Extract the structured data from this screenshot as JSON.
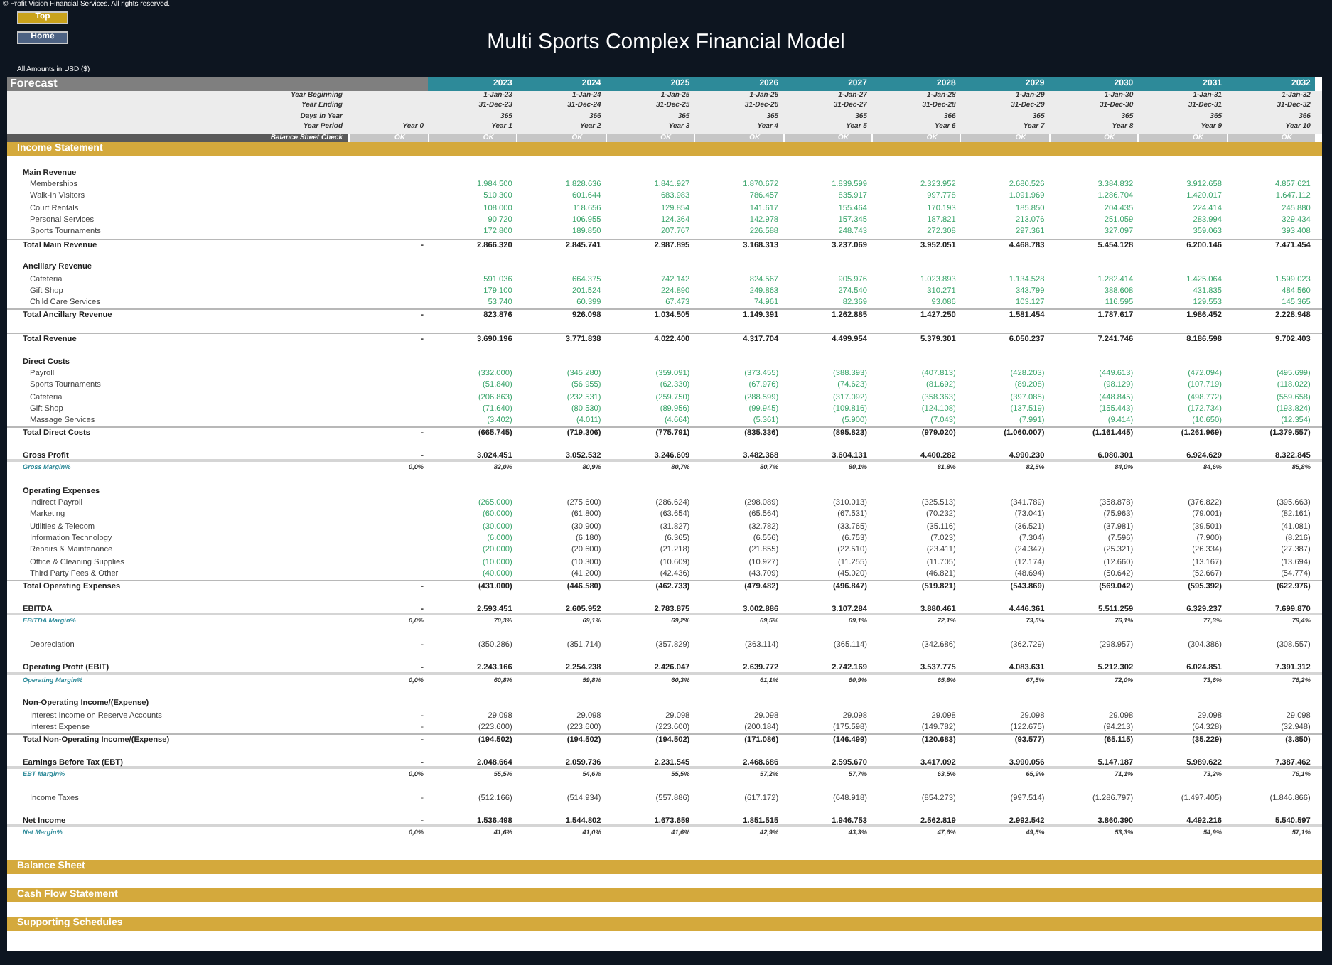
{
  "copyright": "© Profit Vision Financial Services. All rights reserved.",
  "nav_buttons": [
    {
      "label": "Top",
      "kind": "gold"
    },
    {
      "label": "Home",
      "kind": "slate"
    }
  ],
  "title": "Multi Sports Complex Financial Model",
  "currency_note": "All Amounts in  USD ($)",
  "forecast": {
    "label": "Forecast",
    "years": [
      "2023",
      "2024",
      "2025",
      "2026",
      "2027",
      "2028",
      "2029",
      "2030",
      "2031",
      "2032"
    ],
    "header_rows": [
      {
        "label": "Year Beginning",
        "values": [
          "1-Jan-23",
          "1-Jan-24",
          "1-Jan-25",
          "1-Jan-26",
          "1-Jan-27",
          "1-Jan-28",
          "1-Jan-29",
          "1-Jan-30",
          "1-Jan-31",
          "1-Jan-32"
        ]
      },
      {
        "label": "Year Ending",
        "values": [
          "31-Dec-23",
          "31-Dec-24",
          "31-Dec-25",
          "31-Dec-26",
          "31-Dec-27",
          "31-Dec-28",
          "31-Dec-29",
          "31-Dec-30",
          "31-Dec-31",
          "31-Dec-32"
        ]
      },
      {
        "label": "Days in Year",
        "values": [
          "365",
          "366",
          "365",
          "365",
          "365",
          "366",
          "365",
          "365",
          "365",
          "366"
        ]
      },
      {
        "label": "Year Period",
        "year0": "Year 0",
        "values": [
          "Year 1",
          "Year 2",
          "Year 3",
          "Year 4",
          "Year 5",
          "Year 6",
          "Year 7",
          "Year 8",
          "Year 9",
          "Year 10"
        ]
      }
    ],
    "check": {
      "label": "Balance Sheet Check",
      "year0": "OK",
      "values": [
        "OK",
        "OK",
        "OK",
        "OK",
        "OK",
        "OK",
        "OK",
        "OK",
        "OK",
        "OK"
      ]
    }
  },
  "income_statement": {
    "title": "Income Statement",
    "groups": [
      {
        "rows": [
          {
            "kind": "heading",
            "label": "Main Revenue"
          },
          {
            "kind": "input",
            "label": "Memberships",
            "values": [
              "1.984.500",
              "1.828.636",
              "1.841.927",
              "1.870.672",
              "1.839.599",
              "2.323.952",
              "2.680.526",
              "3.384.832",
              "3.912.658",
              "4.857.621"
            ]
          },
          {
            "kind": "input",
            "label": "Walk-In Visitors",
            "values": [
              "510.300",
              "601.644",
              "683.983",
              "786.457",
              "835.917",
              "997.778",
              "1.091.969",
              "1.286.704",
              "1.420.017",
              "1.647.112"
            ]
          },
          {
            "kind": "input",
            "label": "Court Rentals",
            "values": [
              "108.000",
              "118.656",
              "129.854",
              "141.617",
              "155.464",
              "170.193",
              "185.850",
              "204.435",
              "224.414",
              "245.880"
            ]
          },
          {
            "kind": "input",
            "label": "Personal Services",
            "values": [
              "90.720",
              "106.955",
              "124.364",
              "142.978",
              "157.345",
              "187.821",
              "213.076",
              "251.059",
              "283.994",
              "329.434"
            ]
          },
          {
            "kind": "input",
            "label": "Sports Tournaments",
            "values": [
              "172.800",
              "189.850",
              "207.767",
              "226.588",
              "248.743",
              "272.308",
              "297.361",
              "327.097",
              "359.063",
              "393.408"
            ]
          },
          {
            "kind": "total",
            "label": "Total Main Revenue",
            "year0": "-",
            "values": [
              "2.866.320",
              "2.845.741",
              "2.987.895",
              "3.168.313",
              "3.237.069",
              "3.952.051",
              "4.468.783",
              "5.454.128",
              "6.200.146",
              "7.471.454"
            ]
          }
        ]
      },
      {
        "rows": [
          {
            "kind": "heading",
            "label": "Ancillary Revenue"
          },
          {
            "kind": "input",
            "label": "Cafeteria",
            "values": [
              "591.036",
              "664.375",
              "742.142",
              "824.567",
              "905.976",
              "1.023.893",
              "1.134.528",
              "1.282.414",
              "1.425.064",
              "1.599.023"
            ]
          },
          {
            "kind": "input",
            "label": "Gift Shop",
            "values": [
              "179.100",
              "201.524",
              "224.890",
              "249.863",
              "274.540",
              "310.271",
              "343.799",
              "388.608",
              "431.835",
              "484.560"
            ]
          },
          {
            "kind": "input",
            "label": "Child Care Services",
            "values": [
              "53.740",
              "60.399",
              "67.473",
              "74.961",
              "82.369",
              "93.086",
              "103.127",
              "116.595",
              "129.553",
              "145.365"
            ]
          },
          {
            "kind": "total",
            "label": "Total Ancillary Revenue",
            "year0": "-",
            "values": [
              "823.876",
              "926.098",
              "1.034.505",
              "1.149.391",
              "1.262.885",
              "1.427.250",
              "1.581.454",
              "1.787.617",
              "1.986.452",
              "2.228.948"
            ]
          }
        ]
      },
      {
        "rows": [
          {
            "kind": "total",
            "label": "Total Revenue",
            "year0": "-",
            "values": [
              "3.690.196",
              "3.771.838",
              "4.022.400",
              "4.317.704",
              "4.499.954",
              "5.379.301",
              "6.050.237",
              "7.241.746",
              "8.186.598",
              "9.702.403"
            ]
          }
        ]
      },
      {
        "rows": [
          {
            "kind": "heading",
            "label": "Direct Costs"
          },
          {
            "kind": "input",
            "label": "Payroll",
            "values": [
              "(332.000)",
              "(345.280)",
              "(359.091)",
              "(373.455)",
              "(388.393)",
              "(407.813)",
              "(428.203)",
              "(449.613)",
              "(472.094)",
              "(495.699)"
            ]
          },
          {
            "kind": "input",
            "label": "Sports Tournaments",
            "values": [
              "(51.840)",
              "(56.955)",
              "(62.330)",
              "(67.976)",
              "(74.623)",
              "(81.692)",
              "(89.208)",
              "(98.129)",
              "(107.719)",
              "(118.022)"
            ]
          },
          {
            "kind": "input",
            "label": "Cafeteria",
            "values": [
              "(206.863)",
              "(232.531)",
              "(259.750)",
              "(288.599)",
              "(317.092)",
              "(358.363)",
              "(397.085)",
              "(448.845)",
              "(498.772)",
              "(559.658)"
            ]
          },
          {
            "kind": "input",
            "label": "Gift Shop",
            "values": [
              "(71.640)",
              "(80.530)",
              "(89.956)",
              "(99.945)",
              "(109.816)",
              "(124.108)",
              "(137.519)",
              "(155.443)",
              "(172.734)",
              "(193.824)"
            ]
          },
          {
            "kind": "input",
            "label": "Massage Services",
            "values": [
              "(3.402)",
              "(4.011)",
              "(4.664)",
              "(5.361)",
              "(5.900)",
              "(7.043)",
              "(7.991)",
              "(9.414)",
              "(10.650)",
              "(12.354)"
            ]
          },
          {
            "kind": "total",
            "label": "Total Direct Costs",
            "year0": "-",
            "values": [
              "(665.745)",
              "(719.306)",
              "(775.791)",
              "(835.336)",
              "(895.823)",
              "(979.020)",
              "(1.060.007)",
              "(1.161.445)",
              "(1.261.969)",
              "(1.379.557)"
            ]
          }
        ]
      },
      {
        "rows": [
          {
            "kind": "key",
            "label": "Gross Profit",
            "year0": "-",
            "values": [
              "3.024.451",
              "3.052.532",
              "3.246.609",
              "3.482.368",
              "3.604.131",
              "4.400.282",
              "4.990.230",
              "6.080.301",
              "6.924.629",
              "8.322.845"
            ]
          },
          {
            "kind": "margin",
            "label": "Gross Margin%",
            "year0": "0,0%",
            "values": [
              "82,0%",
              "80,9%",
              "80,7%",
              "80,7%",
              "80,1%",
              "81,8%",
              "82,5%",
              "84,0%",
              "84,6%",
              "85,8%"
            ]
          }
        ]
      },
      {
        "rows": [
          {
            "kind": "heading",
            "label": "Operating Expenses"
          },
          {
            "kind": "mixed",
            "label": "Indirect Payroll",
            "values": [
              "(265.000)",
              "(275.600)",
              "(286.624)",
              "(298.089)",
              "(310.013)",
              "(325.513)",
              "(341.789)",
              "(358.878)",
              "(376.822)",
              "(395.663)"
            ]
          },
          {
            "kind": "mixed",
            "label": "Marketing",
            "values": [
              "(60.000)",
              "(61.800)",
              "(63.654)",
              "(65.564)",
              "(67.531)",
              "(70.232)",
              "(73.041)",
              "(75.963)",
              "(79.001)",
              "(82.161)"
            ]
          },
          {
            "kind": "mixed",
            "label": "Utilities & Telecom",
            "values": [
              "(30.000)",
              "(30.900)",
              "(31.827)",
              "(32.782)",
              "(33.765)",
              "(35.116)",
              "(36.521)",
              "(37.981)",
              "(39.501)",
              "(41.081)"
            ]
          },
          {
            "kind": "mixed",
            "label": "Information Technology",
            "values": [
              "(6.000)",
              "(6.180)",
              "(6.365)",
              "(6.556)",
              "(6.753)",
              "(7.023)",
              "(7.304)",
              "(7.596)",
              "(7.900)",
              "(8.216)"
            ]
          },
          {
            "kind": "mixed",
            "label": "Repairs & Maintenance",
            "values": [
              "(20.000)",
              "(20.600)",
              "(21.218)",
              "(21.855)",
              "(22.510)",
              "(23.411)",
              "(24.347)",
              "(25.321)",
              "(26.334)",
              "(27.387)"
            ]
          },
          {
            "kind": "mixed",
            "label": "Office & Cleaning Supplies",
            "values": [
              "(10.000)",
              "(10.300)",
              "(10.609)",
              "(10.927)",
              "(11.255)",
              "(11.705)",
              "(12.174)",
              "(12.660)",
              "(13.167)",
              "(13.694)"
            ]
          },
          {
            "kind": "mixed",
            "label": "Third Party Fees & Other",
            "values": [
              "(40.000)",
              "(41.200)",
              "(42.436)",
              "(43.709)",
              "(45.020)",
              "(46.821)",
              "(48.694)",
              "(50.642)",
              "(52.667)",
              "(54.774)"
            ]
          },
          {
            "kind": "total",
            "label": "Total Operating Expenses",
            "year0": "-",
            "values": [
              "(431.000)",
              "(446.580)",
              "(462.733)",
              "(479.482)",
              "(496.847)",
              "(519.821)",
              "(543.869)",
              "(569.042)",
              "(595.392)",
              "(622.976)"
            ]
          }
        ]
      },
      {
        "rows": [
          {
            "kind": "key",
            "label": "EBITDA",
            "year0": "-",
            "values": [
              "2.593.451",
              "2.605.952",
              "2.783.875",
              "3.002.886",
              "3.107.284",
              "3.880.461",
              "4.446.361",
              "5.511.259",
              "6.329.237",
              "7.699.870"
            ]
          },
          {
            "kind": "margin",
            "label": "EBITDA Margin%",
            "year0": "0,0%",
            "values": [
              "70,3%",
              "69,1%",
              "69,2%",
              "69,5%",
              "69,1%",
              "72,1%",
              "73,5%",
              "76,1%",
              "77,3%",
              "79,4%"
            ]
          }
        ]
      },
      {
        "rows": [
          {
            "kind": "plain",
            "label": "Depreciation",
            "year0": "-",
            "values": [
              "(350.286)",
              "(351.714)",
              "(357.829)",
              "(363.114)",
              "(365.114)",
              "(342.686)",
              "(362.729)",
              "(298.957)",
              "(304.386)",
              "(308.557)"
            ]
          }
        ]
      },
      {
        "rows": [
          {
            "kind": "key",
            "label": "Operating Profit (EBIT)",
            "year0": "-",
            "values": [
              "2.243.166",
              "2.254.238",
              "2.426.047",
              "2.639.772",
              "2.742.169",
              "3.537.775",
              "4.083.631",
              "5.212.302",
              "6.024.851",
              "7.391.312"
            ]
          },
          {
            "kind": "margin",
            "label": "Operating Margin%",
            "year0": "0,0%",
            "values": [
              "60,8%",
              "59,8%",
              "60,3%",
              "61,1%",
              "60,9%",
              "65,8%",
              "67,5%",
              "72,0%",
              "73,6%",
              "76,2%"
            ]
          }
        ]
      },
      {
        "rows": [
          {
            "kind": "heading",
            "label": "Non-Operating Income/(Expense)"
          },
          {
            "kind": "plain",
            "label": "Interest Income on Reserve Accounts",
            "year0": "-",
            "values": [
              "29.098",
              "29.098",
              "29.098",
              "29.098",
              "29.098",
              "29.098",
              "29.098",
              "29.098",
              "29.098",
              "29.098"
            ]
          },
          {
            "kind": "plain",
            "label": "Interest Expense",
            "year0": "-",
            "values": [
              "(223.600)",
              "(223.600)",
              "(223.600)",
              "(200.184)",
              "(175.598)",
              "(149.782)",
              "(122.675)",
              "(94.213)",
              "(64.328)",
              "(32.948)"
            ]
          },
          {
            "kind": "total",
            "label": "Total Non-Operating Income/(Expense)",
            "year0": "-",
            "values": [
              "(194.502)",
              "(194.502)",
              "(194.502)",
              "(171.086)",
              "(146.499)",
              "(120.683)",
              "(93.577)",
              "(65.115)",
              "(35.229)",
              "(3.850)"
            ]
          }
        ]
      },
      {
        "rows": [
          {
            "kind": "key",
            "label": "Earnings Before Tax (EBT)",
            "year0": "-",
            "values": [
              "2.048.664",
              "2.059.736",
              "2.231.545",
              "2.468.686",
              "2.595.670",
              "3.417.092",
              "3.990.056",
              "5.147.187",
              "5.989.622",
              "7.387.462"
            ]
          },
          {
            "kind": "margin",
            "label": "EBT Margin%",
            "year0": "0,0%",
            "values": [
              "55,5%",
              "54,6%",
              "55,5%",
              "57,2%",
              "57,7%",
              "63,5%",
              "65,9%",
              "71,1%",
              "73,2%",
              "76,1%"
            ]
          }
        ]
      },
      {
        "rows": [
          {
            "kind": "plain",
            "label": "Income Taxes",
            "year0": "-",
            "values": [
              "(512.166)",
              "(514.934)",
              "(557.886)",
              "(617.172)",
              "(648.918)",
              "(854.273)",
              "(997.514)",
              "(1.286.797)",
              "(1.497.405)",
              "(1.846.866)"
            ]
          }
        ]
      },
      {
        "rows": [
          {
            "kind": "key",
            "label": "Net Income",
            "year0": "-",
            "values": [
              "1.536.498",
              "1.544.802",
              "1.673.659",
              "1.851.515",
              "1.946.753",
              "2.562.819",
              "2.992.542",
              "3.860.390",
              "4.492.216",
              "5.540.597"
            ]
          },
          {
            "kind": "margin",
            "label": "Net Margin%",
            "year0": "0,0%",
            "values": [
              "41,6%",
              "41,0%",
              "41,6%",
              "42,9%",
              "43,3%",
              "47,6%",
              "49,5%",
              "53,3%",
              "54,9%",
              "57,1%"
            ]
          }
        ]
      }
    ]
  },
  "collapsed_sections": [
    "Balance Sheet",
    "Cash Flow Statement",
    "Supporting Schedules"
  ]
}
